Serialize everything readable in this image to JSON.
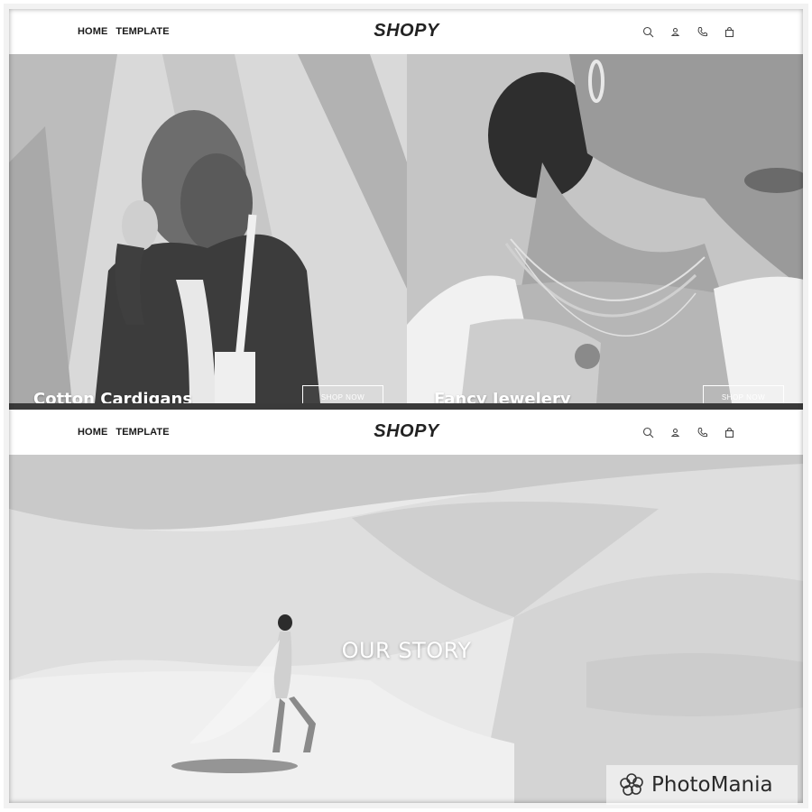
{
  "header": {
    "nav_links": [
      "HOME",
      "TEMPLATE"
    ],
    "brand": "SHOPY",
    "icons": [
      "search-icon",
      "user-icon",
      "phone-icon",
      "bag-icon"
    ]
  },
  "hero_tiles": [
    {
      "title": "Cotton Cardigans",
      "button": "SHOP NOW"
    },
    {
      "title": "Fancy Jewelery",
      "button": "SHOP NOW"
    }
  ],
  "story": {
    "title": "OUR STORY"
  },
  "watermark": {
    "text": "PhotoMania"
  },
  "colors": {
    "header_bg": "#ffffff",
    "text_dark": "#1a1a1a",
    "overlay_text": "#ffffff"
  }
}
